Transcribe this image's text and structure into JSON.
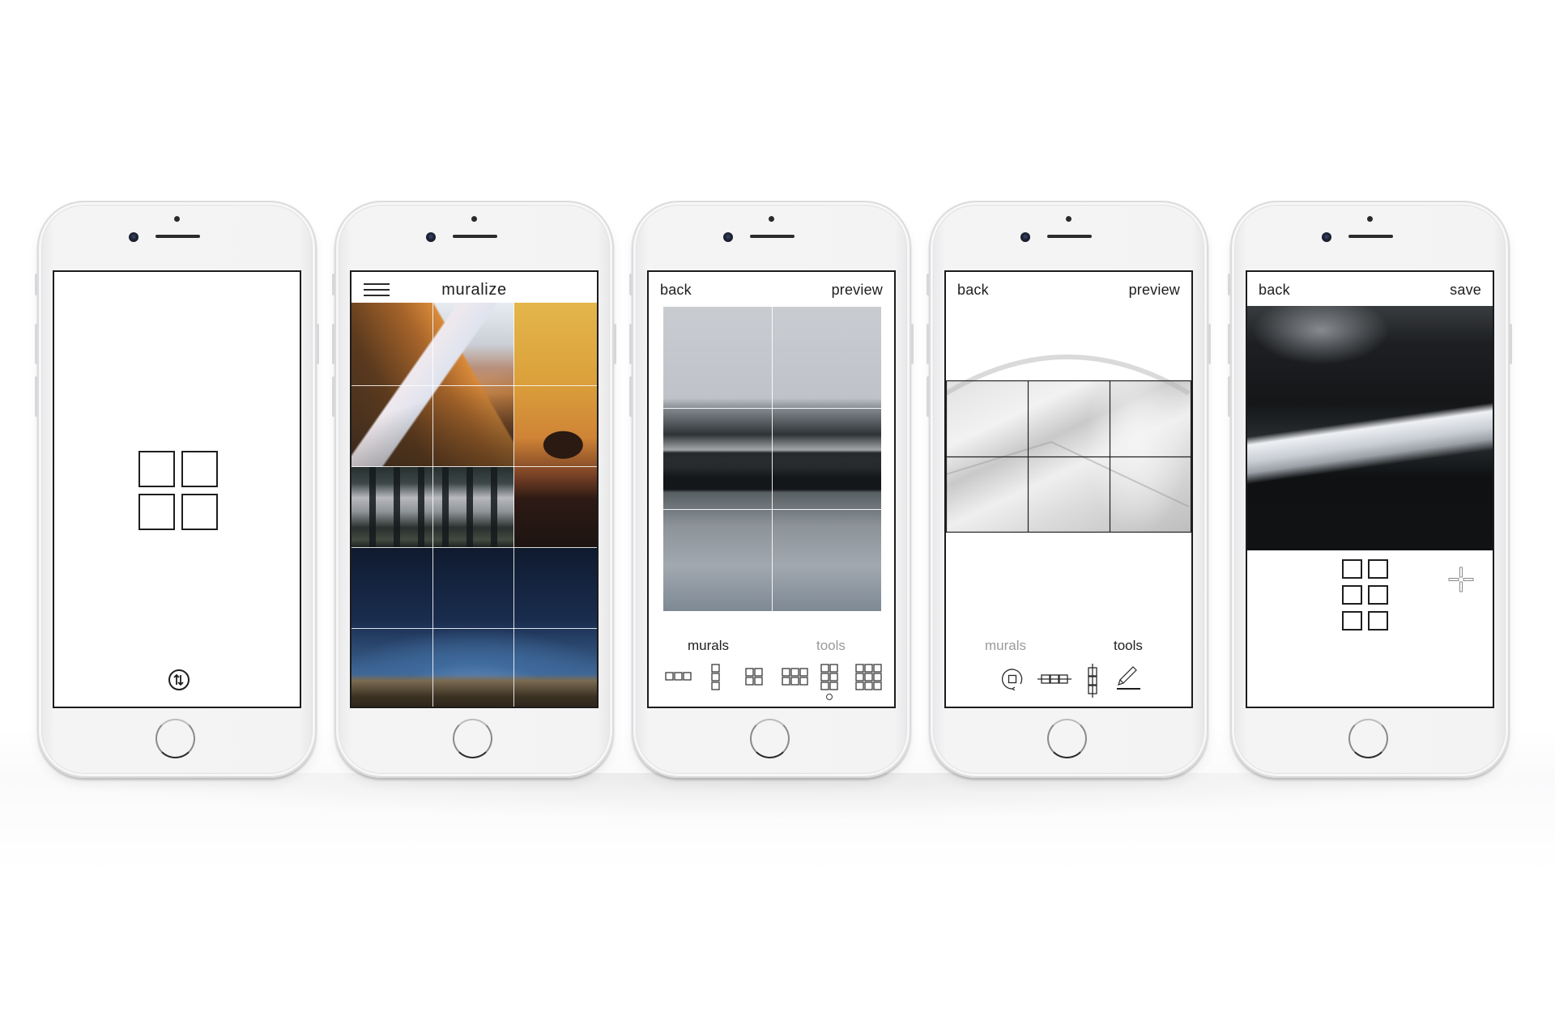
{
  "app": {
    "name": "muralize"
  },
  "phones": [
    {
      "id": "splash",
      "logo_icon": "four-square-grid-icon",
      "bottom_icon": "circled-swap-arrows-icon"
    },
    {
      "id": "gallery",
      "menu_icon": "hamburger-menu-icon",
      "title": "muralize",
      "mural_tiles": [
        {
          "subject": "sunlit snowy mountain ridge",
          "cols": 2,
          "rows": 2
        },
        {
          "subject": "camel silhouette at sunset",
          "cols": 1,
          "rows": 3
        },
        {
          "subject": "subway platform",
          "cols": 2,
          "rows": 1
        },
        {
          "subject": "starry night sky over mountains",
          "cols": 3,
          "rows": 2
        }
      ]
    },
    {
      "id": "editor-murals",
      "back_label": "back",
      "preview_label": "preview",
      "photo_subject": "misty lake with snowy shore and forest reflection",
      "grid": {
        "cols": 2,
        "rows": 3
      },
      "tabs": [
        {
          "label": "murals",
          "active": true
        },
        {
          "label": "tools",
          "active": false
        }
      ],
      "layouts": [
        {
          "name": "layout-3x1",
          "cols": 3,
          "rows": 1,
          "selected": false
        },
        {
          "name": "layout-1x3",
          "cols": 1,
          "rows": 3,
          "selected": false
        },
        {
          "name": "layout-2x2",
          "cols": 2,
          "rows": 2,
          "selected": false
        },
        {
          "name": "layout-3x2",
          "cols": 3,
          "rows": 2,
          "selected": false
        },
        {
          "name": "layout-2x3",
          "cols": 2,
          "rows": 3,
          "selected": true
        },
        {
          "name": "layout-3x3",
          "cols": 3,
          "rows": 3,
          "selected": false
        }
      ]
    },
    {
      "id": "editor-tools",
      "back_label": "back",
      "preview_label": "preview",
      "photo_subject": "white arched architectural corridor",
      "grid": {
        "cols": 3,
        "rows": 2
      },
      "tabs": [
        {
          "label": "murals",
          "active": false
        },
        {
          "label": "tools",
          "active": true
        }
      ],
      "tools": [
        {
          "name": "rotate",
          "icon": "rotate-square-icon"
        },
        {
          "name": "flip-horizontal",
          "icon": "flip-horizontal-icon"
        },
        {
          "name": "flip-vertical",
          "icon": "flip-vertical-icon"
        },
        {
          "name": "draw",
          "icon": "pencil-underline-icon"
        }
      ]
    },
    {
      "id": "preview-save",
      "back_label": "back",
      "save_label": "save",
      "photo_subject": "dark forest and snowy lakeshore tile",
      "tile_map_icon": "six-square-grid-icon",
      "move_icon": "crosshair-move-icon"
    }
  ],
  "colors": {
    "ink": "#1e1e1e",
    "inactive_tab": "#9a9a9a",
    "device_body": "#f3f3f4",
    "grid_line_light": "#ffffff",
    "grid_line_dark": "#222222"
  }
}
